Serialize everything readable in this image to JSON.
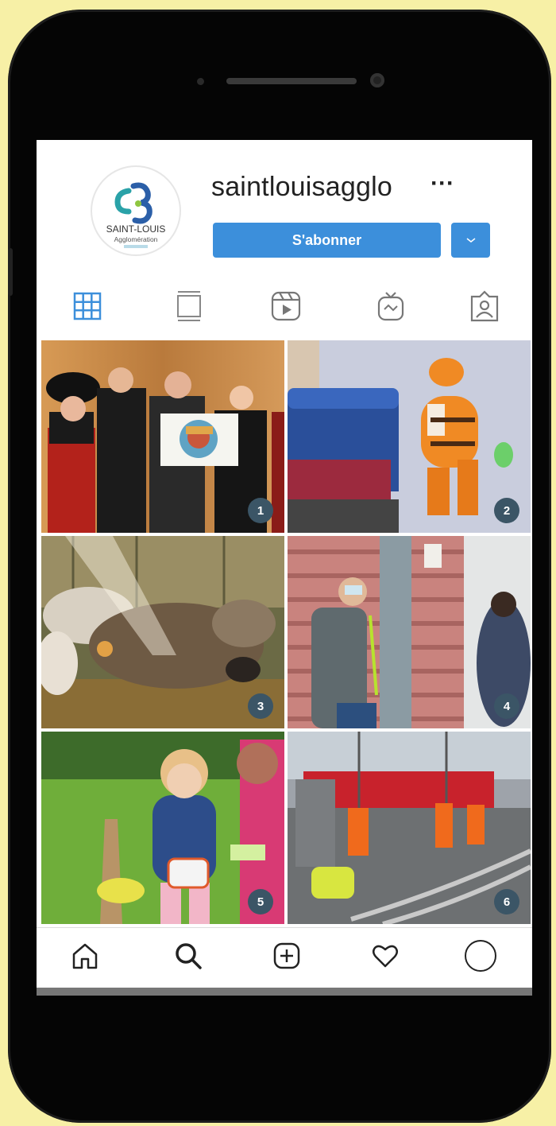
{
  "profile": {
    "username": "saintlouisagglo",
    "more_label": "···",
    "follow_label": "S'abonner",
    "dropdown_label": "⌄",
    "logo_text": "SAINT-LOUIS",
    "logo_subtext": "Agglomération"
  },
  "tabs": [
    {
      "icon": "grid-icon",
      "active": true
    },
    {
      "icon": "feed-icon",
      "active": false
    },
    {
      "icon": "reels-icon",
      "active": false
    },
    {
      "icon": "igtv-icon",
      "active": false
    },
    {
      "icon": "tagged-icon",
      "active": false
    }
  ],
  "posts": [
    {
      "number": "1",
      "subject": "group-photo"
    },
    {
      "number": "2",
      "subject": "tiger-costume"
    },
    {
      "number": "3",
      "subject": "sheep"
    },
    {
      "number": "4",
      "subject": "people-at-building"
    },
    {
      "number": "5",
      "subject": "child-easter"
    },
    {
      "number": "6",
      "subject": "tram-works"
    }
  ],
  "nav": [
    {
      "icon": "home-icon"
    },
    {
      "icon": "search-icon"
    },
    {
      "icon": "add-icon"
    },
    {
      "icon": "heart-icon"
    },
    {
      "icon": "profile-icon"
    }
  ],
  "colors": {
    "background": "#f7f0a6",
    "accent": "#3c8fdb",
    "badge": "#3b5566"
  }
}
